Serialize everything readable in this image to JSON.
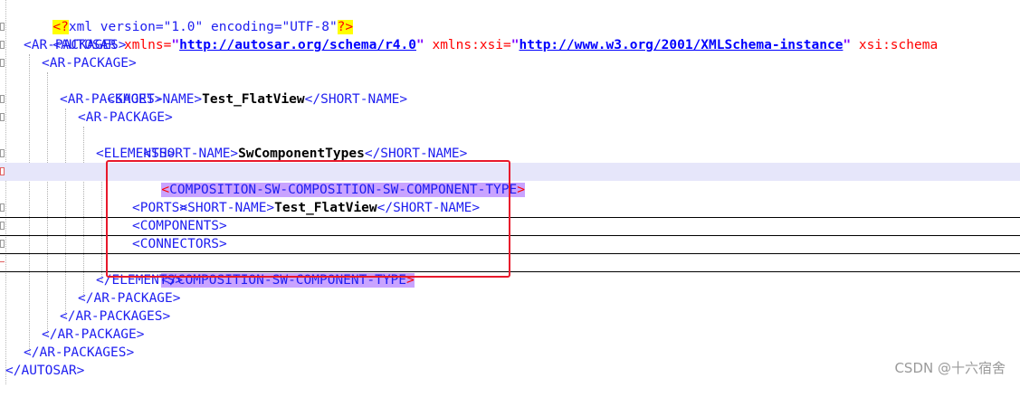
{
  "editor": {
    "line1": {
      "pi_open": "<?",
      "decl": "xml version=\"1.0\" encoding=\"UTF-8\"",
      "pi_close": "?>"
    },
    "line2": {
      "open": "<AUTOSAR ",
      "attr1": "xmlns=",
      "q": "\"",
      "url1": "http://autosar.org/schema/r4.0",
      "attr2": " xmlns:xsi=",
      "url2": "http://www.w3.org/2001/XMLSchema-instance",
      "attr3": " xsi:schema"
    },
    "line3": "<AR-PACKAGES>",
    "line4": "<AR-PACKAGE>",
    "line5": {
      "open": "<SHORT-NAME>",
      "value": "Test_FlatView",
      "close": "</SHORT-NAME>"
    },
    "line6": "<AR-PACKAGES>",
    "line7": "<AR-PACKAGE>",
    "line8": {
      "open": "<SHORT-NAME>",
      "value": "SwComponentTypes",
      "close": "</SHORT-NAME>"
    },
    "line9": "<ELEMENTS>",
    "line10": {
      "lt": "<",
      "name_a": "COMPOSITION-SW-COMPOSI",
      "name_b": "TION-SW-COMPONENT-TYPE",
      "gt": ">"
    },
    "line11": {
      "open": "<SHORT-NAME>",
      "value": "Test_FlatView",
      "close": "</SHORT-NAME>"
    },
    "line12": "<PORTS>",
    "line13": "<COMPONENTS>",
    "line14": "<CONNECTORS>",
    "line15": {
      "body": "</COMPOSITION-SW-COMPONENT-TYPE",
      "gt": ">"
    },
    "line16": "</ELEMENTS>",
    "line17": "</AR-PACKAGE>",
    "line18": "</AR-PACKAGES>",
    "line19": "</AR-PACKAGE>",
    "line20": "</AR-PACKAGES>",
    "line21": "</AUTOSAR>"
  },
  "watermark": "CSDN @十六宿舍",
  "colors": {
    "tag": "#1e1ef0",
    "attribute": "#ff0000",
    "string": "#8000ff",
    "selection": "#c9a3ff",
    "current_line": "#e6e6fa",
    "annotation_box": "#e8192c"
  }
}
